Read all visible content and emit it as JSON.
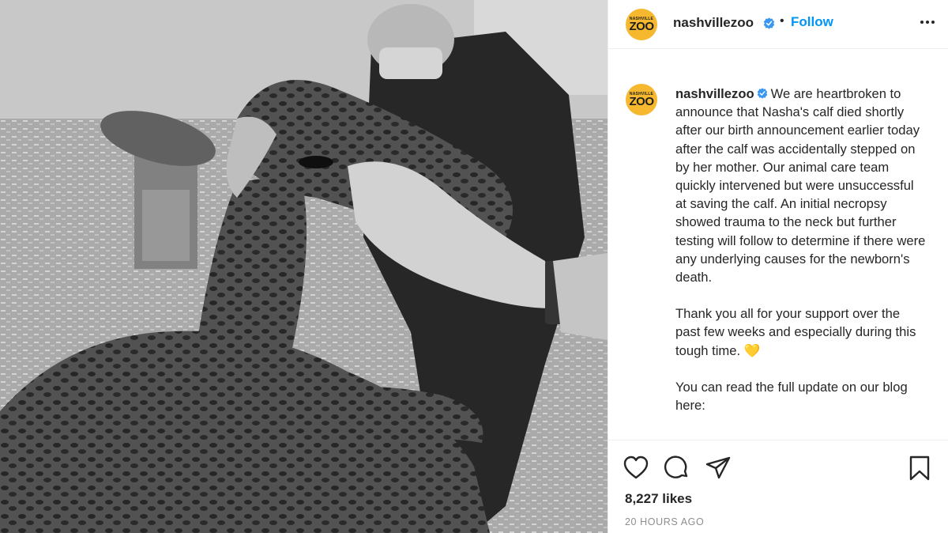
{
  "account": {
    "username": "nashvillezoo",
    "avatar_text_small": "NASHVILLE",
    "avatar_text_big": "ZOO",
    "verified_icon": "verified-badge-icon",
    "separator": "•",
    "follow_label": "Follow",
    "more_icon": "more-options-icon"
  },
  "caption": {
    "paragraphs": [
      "We are heartbroken to announce that Nasha's calf died shortly after our birth announcement earlier today after the calf was accidentally stepped on by her mother. Our animal care team quickly intervened but were unsuccessful at saving the calf. An initial necropsy showed trauma to the neck but further testing will follow to determine if there were any underlying causes for the newborn's death.",
      "Thank you all for your support over the past few weeks and especially during this tough time. 💛",
      "You can read the full update on our blog here:"
    ]
  },
  "actions": {
    "like_icon": "heart-icon",
    "comment_icon": "comment-icon",
    "share_icon": "share-icon",
    "save_icon": "bookmark-icon"
  },
  "likes_text": "8,227 likes",
  "time_ago": "20 HOURS AGO",
  "colors": {
    "accent": "#0095f6",
    "avatar_bg": "#f5b82e",
    "muted": "#8e8e8e",
    "text": "#262626"
  }
}
